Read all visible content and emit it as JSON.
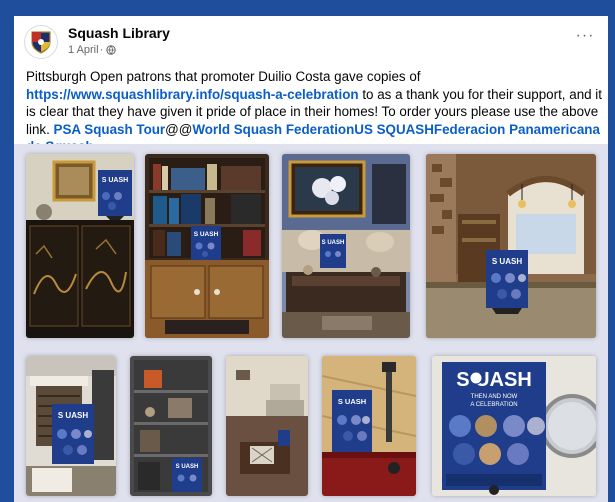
{
  "post": {
    "page_name": "Squash Library",
    "date": "1 April",
    "separator": " · ",
    "more_label": "···",
    "text": {
      "intro": "Pittsburgh Open patrons that promoter Duilio Costa gave copies of ",
      "link": "https://www.squashlibrary.info/squash-a-celebration",
      "middle": " to as a thank you for their support, and it is clear that they have given it pride of place in their homes! To order yours please use the above link. ",
      "tag1": "PSA Squash Tour",
      "at": "@@",
      "tag2": "World Squash Federation",
      "tag3": "US SQUASH",
      "tag4": "Federacion Panamericana de Squash"
    }
  },
  "photos": [
    {
      "name": "photo-1",
      "subject": "black lacquer cabinet with book"
    },
    {
      "name": "photo-2",
      "subject": "bookshelf with book"
    },
    {
      "name": "photo-3",
      "subject": "living room with coffee table and book"
    },
    {
      "name": "photo-4",
      "subject": "stone kitchen with book"
    },
    {
      "name": "photo-5",
      "subject": "fireplace with book"
    },
    {
      "name": "photo-6",
      "subject": "shelves with book"
    },
    {
      "name": "photo-7",
      "subject": "room with chair and table"
    },
    {
      "name": "photo-8",
      "subject": "red table with lamp and book"
    },
    {
      "name": "photo-9",
      "subject": "close-up of book beside mirror"
    }
  ],
  "book_cover": {
    "title_short": "S UASH",
    "title_full": "S  UASH",
    "subtitle_line1": "THEN AND NOW",
    "subtitle_line2": "A CELEBRATION"
  },
  "colors": {
    "background": "#1f4e9c",
    "link": "#0a5ec9",
    "text": "#050505",
    "muted": "#65676b",
    "book_blue": "#1f3d8a"
  }
}
